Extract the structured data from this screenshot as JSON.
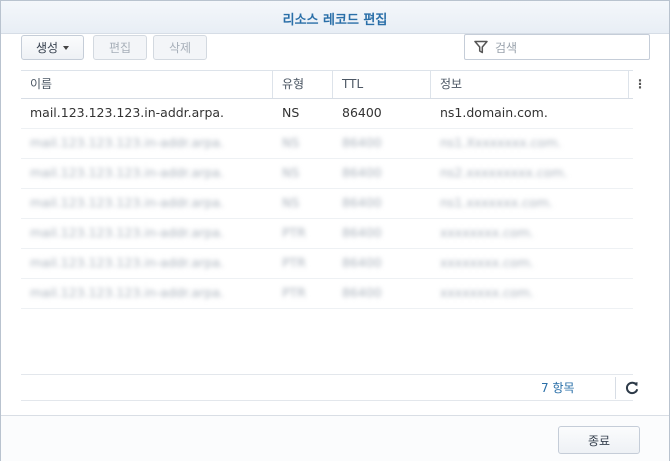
{
  "dialog": {
    "title": "리소스 레코드 편집"
  },
  "toolbar": {
    "create_label": "생성",
    "edit_label": "편집",
    "delete_label": "삭제",
    "search_placeholder": "검색"
  },
  "table": {
    "columns": [
      "이름",
      "유형",
      "TTL",
      "정보"
    ],
    "rows": [
      {
        "name": "mail.123.123.123.in-addr.arpa.",
        "type": "NS",
        "ttl": "86400",
        "info": "ns1.domain.com."
      },
      {
        "name": "mail.123.123.123.in-addr.arpa.",
        "type": "NS",
        "ttl": "86400",
        "info": "ns1.Xxxxxxxx.com."
      },
      {
        "name": "mail.123.123.123.in-addr.arpa.",
        "type": "NS",
        "ttl": "86400",
        "info": "ns2.xxxxxxxxx.com."
      },
      {
        "name": "mail.123.123.123.in-addr.arpa.",
        "type": "NS",
        "ttl": "86400",
        "info": "ns1.xxxxxxx.com."
      },
      {
        "name": "mail.123.123.123.in-addr.arpa.",
        "type": "PTR",
        "ttl": "86400",
        "info": "xxxxxxxx.com."
      },
      {
        "name": "mail.123.123.123.in-addr.arpa.",
        "type": "PTR",
        "ttl": "86400",
        "info": "xxxxxxxx.com."
      },
      {
        "name": "mail.123.123.123.in-addr.arpa.",
        "type": "PTR",
        "ttl": "86400",
        "info": "xxxxxxxx.com."
      }
    ]
  },
  "status": {
    "count_label": "7 항목"
  },
  "footer": {
    "close_label": "종료"
  }
}
